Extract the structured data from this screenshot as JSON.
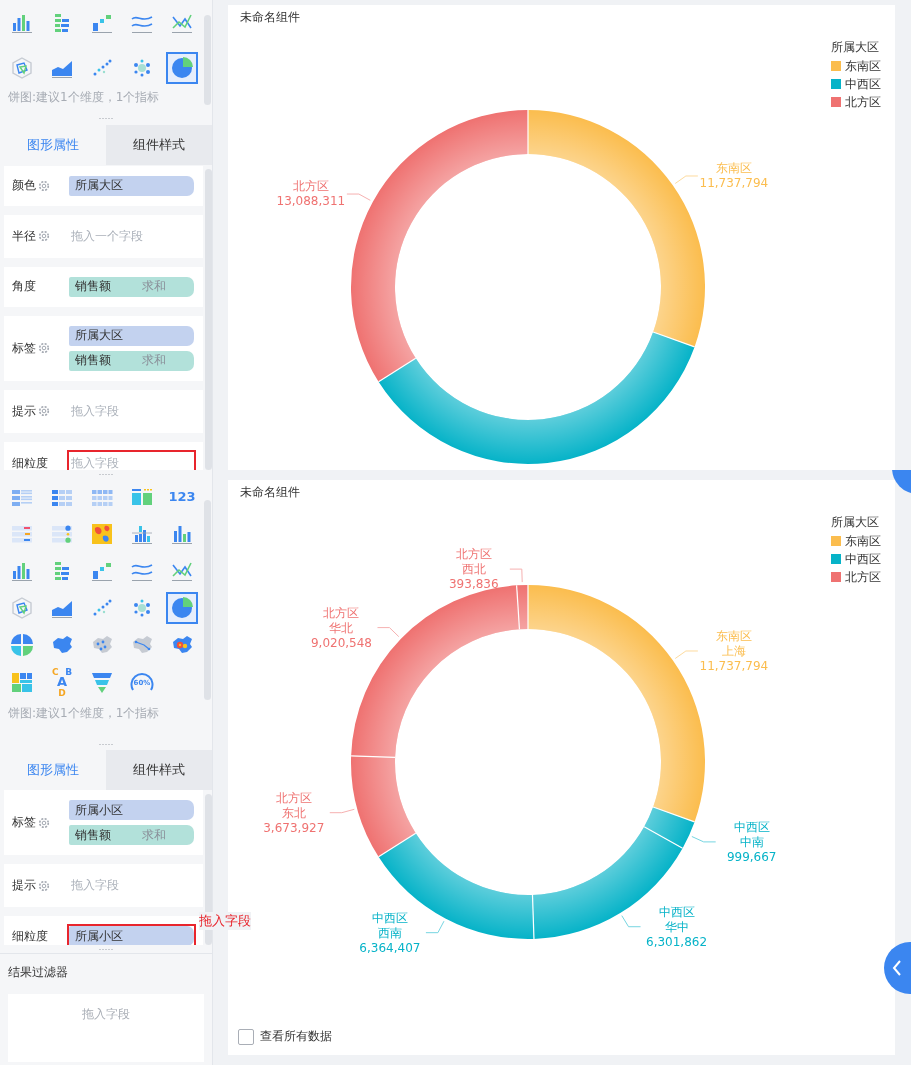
{
  "panes": [
    {
      "sidebar": {
        "chart_types": [
          {
            "kind": "bar",
            "selected": false
          },
          {
            "kind": "hbar",
            "selected": false
          },
          {
            "kind": "step",
            "selected": false
          },
          {
            "kind": "wave",
            "selected": false
          },
          {
            "kind": "crossline",
            "selected": false
          },
          {
            "kind": "radar",
            "selected": false
          },
          {
            "kind": "area",
            "selected": false
          },
          {
            "kind": "scatter",
            "selected": false
          },
          {
            "kind": "bubble",
            "selected": false
          },
          {
            "kind": "pie",
            "selected": true
          }
        ],
        "hint": "饼图:建议1个维度，1个指标",
        "tabs": [
          {
            "label": "图形属性",
            "selected": true
          },
          {
            "label": "组件样式",
            "selected": false
          }
        ],
        "properties": [
          {
            "label": "颜色",
            "settings": true,
            "highlighted": false,
            "chips": [
              {
                "kind": "dimension",
                "text": "所属大区"
              }
            ]
          },
          {
            "label": "半径",
            "settings": true,
            "highlighted": false,
            "placeholder": "拖入一个字段"
          },
          {
            "label": "角度",
            "settings": false,
            "highlighted": false,
            "chips": [
              {
                "kind": "measure",
                "text": "销售额",
                "aggregation": "求和"
              }
            ]
          },
          {
            "label": "标签",
            "settings": true,
            "highlighted": false,
            "chips": [
              {
                "kind": "dimension",
                "text": "所属大区"
              },
              {
                "kind": "measure",
                "text": "销售额",
                "aggregation": "求和"
              }
            ]
          },
          {
            "label": "提示",
            "settings": true,
            "highlighted": false,
            "placeholder": "拖入字段"
          },
          {
            "label": "细粒度",
            "settings": false,
            "highlighted": true,
            "placeholder": "拖入字段"
          }
        ]
      },
      "card": {
        "title": "未命名组件",
        "chart_data": {
          "type": "donut",
          "categories": [
            "东南区",
            "中西区",
            "北方区"
          ],
          "values": [
            11737794,
            13665936,
            13088311
          ],
          "colors": [
            "#fbbd4e",
            "#06b3c8",
            "#ef7271"
          ],
          "value_labels": [
            "11,737,794",
            null,
            "13,088,311"
          ],
          "legend": {
            "title": "所属大区"
          }
        }
      }
    },
    {
      "sidebar": {
        "chart_types": [
          {
            "kind": "table",
            "selected": false
          },
          {
            "kind": "crosstable",
            "selected": false
          },
          {
            "kind": "detailtable",
            "selected": false
          },
          {
            "kind": "kpi",
            "selected": false
          },
          {
            "kind": "number",
            "text": "123",
            "selected": false
          },
          {
            "kind": "colortable",
            "selected": false
          },
          {
            "kind": "dotlist",
            "selected": false
          },
          {
            "kind": "heatmap",
            "selected": false
          },
          {
            "kind": "groupbar",
            "selected": false
          },
          {
            "kind": "bar2",
            "selected": false
          },
          {
            "kind": "bar",
            "selected": false
          },
          {
            "kind": "hbar",
            "selected": false
          },
          {
            "kind": "step",
            "selected": false
          },
          {
            "kind": "wave",
            "selected": false
          },
          {
            "kind": "crossline",
            "selected": false
          },
          {
            "kind": "radar",
            "selected": false
          },
          {
            "kind": "area",
            "selected": false
          },
          {
            "kind": "scatter",
            "selected": false
          },
          {
            "kind": "bubble",
            "selected": false
          },
          {
            "kind": "pie",
            "selected": true
          },
          {
            "kind": "quadpie",
            "selected": false
          },
          {
            "kind": "map",
            "selected": false
          },
          {
            "kind": "pointmap",
            "selected": false
          },
          {
            "kind": "flowmap",
            "selected": false
          },
          {
            "kind": "heatgeo",
            "selected": false
          },
          {
            "kind": "treemap",
            "selected": false
          },
          {
            "kind": "wordcloud",
            "text": "C B A D",
            "selected": false
          },
          {
            "kind": "funnel",
            "selected": false
          },
          {
            "kind": "gauge",
            "text": "60%",
            "selected": false
          }
        ],
        "hint": "饼图:建议1个维度，1个指标",
        "tabs": [
          {
            "label": "图形属性",
            "selected": true
          },
          {
            "label": "组件样式",
            "selected": false
          }
        ],
        "properties": [
          {
            "label": "标签",
            "settings": true,
            "highlighted": false,
            "chips": [
              {
                "kind": "dimension",
                "text": "所属小区"
              },
              {
                "kind": "measure",
                "text": "销售额",
                "aggregation": "求和"
              }
            ]
          },
          {
            "label": "提示",
            "settings": true,
            "highlighted": false,
            "placeholder": "拖入字段"
          },
          {
            "label": "细粒度",
            "settings": false,
            "highlighted": true,
            "chips": [
              {
                "kind": "dimension",
                "text": "所属小区"
              }
            ]
          }
        ],
        "annotation": "拖入字段",
        "filter": {
          "title": "结果过滤器",
          "placeholder": "拖入字段"
        }
      },
      "card": {
        "title": "未命名组件",
        "legend": {
          "title": "所属大区",
          "items": [
            {
              "label": "东南区",
              "color": "#fbbd4e"
            },
            {
              "label": "中西区",
              "color": "#06b3c8"
            },
            {
              "label": "北方区",
              "color": "#ef7271"
            }
          ]
        },
        "chart_data": {
          "type": "donut",
          "categories": [
            "东南区上海",
            "中西区中南",
            "中西区华中",
            "中西区西南",
            "北方区东北",
            "北方区华北",
            "北方区西北"
          ],
          "values": [
            11737794,
            999667,
            6301862,
            6364407,
            3673927,
            9020548,
            393836
          ],
          "colors": [
            "#fbbd4e",
            "#06b3c8",
            "#06b3c8",
            "#06b3c8",
            "#ef7271",
            "#ef7271",
            "#ef7271"
          ],
          "value_labels": [
            "11,737,794",
            "999,667",
            "6,301,862",
            "6,364,407",
            "3,673,927",
            "9,020,548",
            "393,836"
          ]
        },
        "show_all": {
          "label": "查看所有数据",
          "checked": false
        }
      }
    }
  ]
}
